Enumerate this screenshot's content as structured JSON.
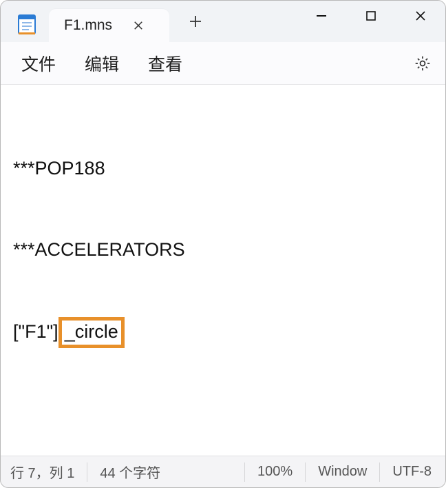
{
  "app": {
    "icon": "notepad-icon"
  },
  "tab": {
    "title": "F1.mns"
  },
  "menu": {
    "file": "文件",
    "edit": "编辑",
    "view": "查看"
  },
  "content": {
    "line1": "***POP188",
    "line2": "***ACCELERATORS",
    "line3_prefix": "[\"F1\"]",
    "line3_highlight": "_circle"
  },
  "status": {
    "pos": "行 7，列 1",
    "chars": "44 个字符",
    "zoom": "100%",
    "eol": "Window",
    "encoding": "UTF-8"
  }
}
